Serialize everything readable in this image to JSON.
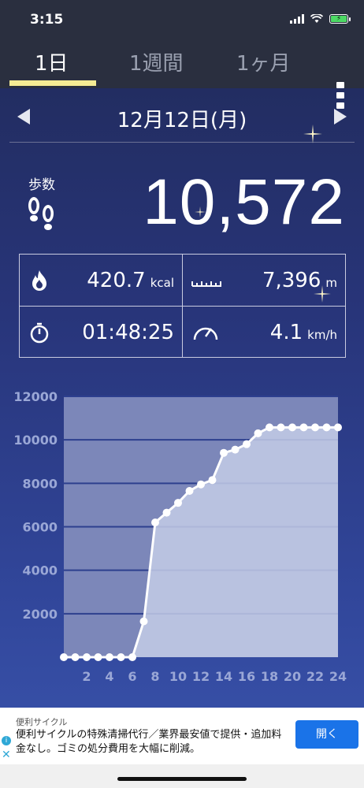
{
  "status": {
    "time": "3:15"
  },
  "tabs": [
    {
      "label": "1日",
      "active": true
    },
    {
      "label": "1週間",
      "active": false
    },
    {
      "label": "1ヶ月",
      "active": false
    }
  ],
  "date": "12月12日(月)",
  "steps": {
    "label": "歩数",
    "value": "10,572"
  },
  "stats": {
    "calories": {
      "value": "420.7",
      "unit": "kcal",
      "icon": "fire-icon"
    },
    "distance": {
      "value": "7,396",
      "unit": "m",
      "icon": "ruler-icon"
    },
    "duration": {
      "value": "01:48:25",
      "icon": "stopwatch-icon"
    },
    "speed": {
      "value": "4.1",
      "unit": "km/h",
      "icon": "speedometer-icon"
    }
  },
  "chart_data": {
    "type": "area",
    "x": [
      0,
      1,
      2,
      3,
      4,
      5,
      6,
      7,
      8,
      9,
      10,
      11,
      12,
      13,
      14,
      15,
      16,
      17,
      18,
      19,
      20,
      21,
      22,
      23,
      24
    ],
    "values": [
      0,
      0,
      0,
      0,
      0,
      0,
      0,
      1650,
      6200,
      6650,
      7100,
      7650,
      7950,
      8150,
      9400,
      9550,
      9800,
      10300,
      10572,
      10572,
      10572,
      10572,
      10572,
      10572,
      10572
    ],
    "xticks": [
      "2",
      "4",
      "6",
      "8",
      "10",
      "12",
      "14",
      "16",
      "18",
      "20",
      "22",
      "24"
    ],
    "yticks": [
      "2000",
      "4000",
      "6000",
      "8000",
      "10000",
      "12000"
    ],
    "ylim": [
      0,
      12000
    ],
    "xlim": [
      0,
      24
    ],
    "grid": true,
    "colors": {
      "line": "#ffffff",
      "fill": "#c4cde6",
      "plot_bg": "#7c87b9",
      "grid": "#2d3f8e",
      "tick": "#9aa7d6"
    }
  },
  "ad": {
    "source": "便利サイクル",
    "text": "便利サイクルの特殊清掃代行／業界最安値で提供・追加料金なし。ゴミの処分費用を大幅に削減。",
    "button": "開く"
  }
}
